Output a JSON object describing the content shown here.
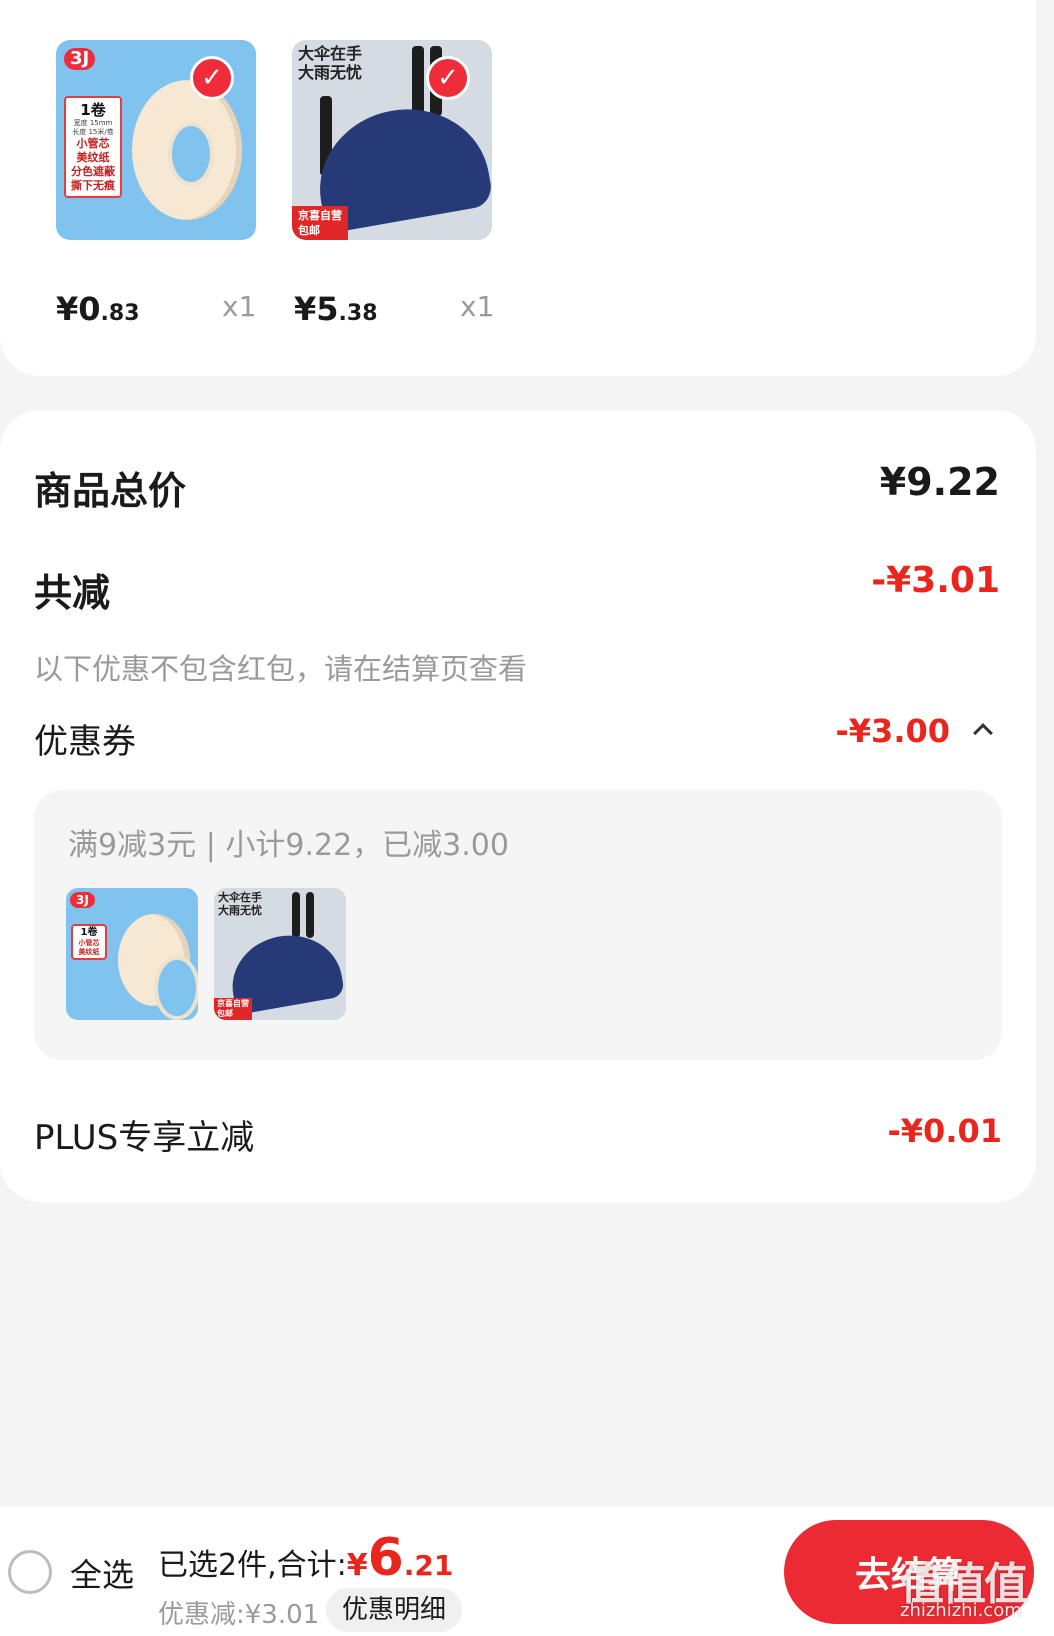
{
  "products": [
    {
      "name": "tape",
      "price_main": "¥0",
      "price_decimal": ".83",
      "qty": "x1",
      "image_text": {
        "badge": "3J",
        "lines": [
          "1卷",
          "宽度 15mm",
          "长度 15米/卷",
          "小管芯",
          "美纹纸",
          "分色遮蔽",
          "撕下无痕"
        ]
      }
    },
    {
      "name": "umbrella",
      "price_main": "¥5",
      "price_decimal": ".38",
      "qty": "x1",
      "image_text": {
        "headline_1": "大伞在手",
        "headline_2": "大雨无忧",
        "promo_1": "京喜自营",
        "promo_2": "包邮"
      }
    }
  ],
  "summary": {
    "total_label": "商品总价",
    "total_value": "¥9.22",
    "reduce_label": "共减",
    "reduce_value": "-¥3.01",
    "reduce_note": "以下优惠不包含红包，请在结算页查看",
    "coupon_label": "优惠券",
    "coupon_value": "-¥3.00",
    "coupon_detail": "满9减3元 | 小计9.22，已减3.00",
    "plus_label": "PLUS专享立减",
    "plus_value": "-¥0.01"
  },
  "bottom_bar": {
    "select_all": "全选",
    "total_prefix": "已选2件,合计:",
    "total_currency": "¥",
    "total_int": "6",
    "total_dec": ".21",
    "discount": "优惠减:¥3.01",
    "detail_button": "优惠明细",
    "checkout_button": "去结算"
  },
  "watermark": {
    "text": "值值值",
    "site": "zhizhizhi.com"
  },
  "colors": {
    "accent_red": "#e8261d",
    "button_red": "#ec2a33",
    "page_bg": "#f4f4f4"
  }
}
